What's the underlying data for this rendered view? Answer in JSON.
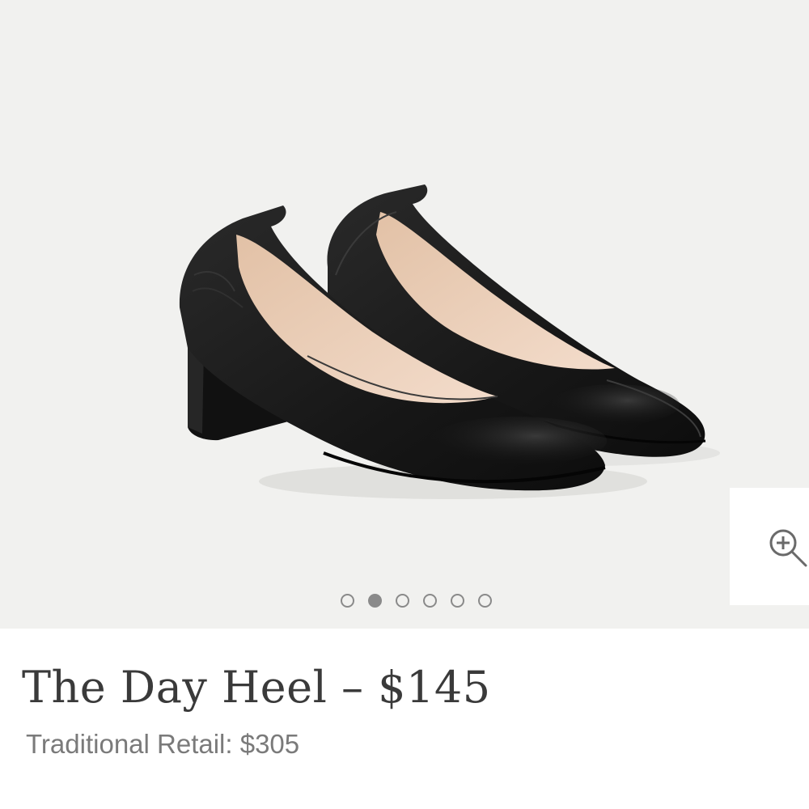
{
  "product": {
    "title": "The Day Heel – $145",
    "traditional_retail": "Traditional Retail: $305",
    "image_alt": "Black leather block-heel pumps"
  },
  "gallery": {
    "slide_count": 6,
    "active_slide": 2,
    "zoom_icon": "zoom-in-icon",
    "background_color": "#f1f1ef"
  },
  "colors": {
    "title_text": "#3a3a3a",
    "muted_text": "#7a7a7a",
    "dot": "#8a8a8a"
  }
}
